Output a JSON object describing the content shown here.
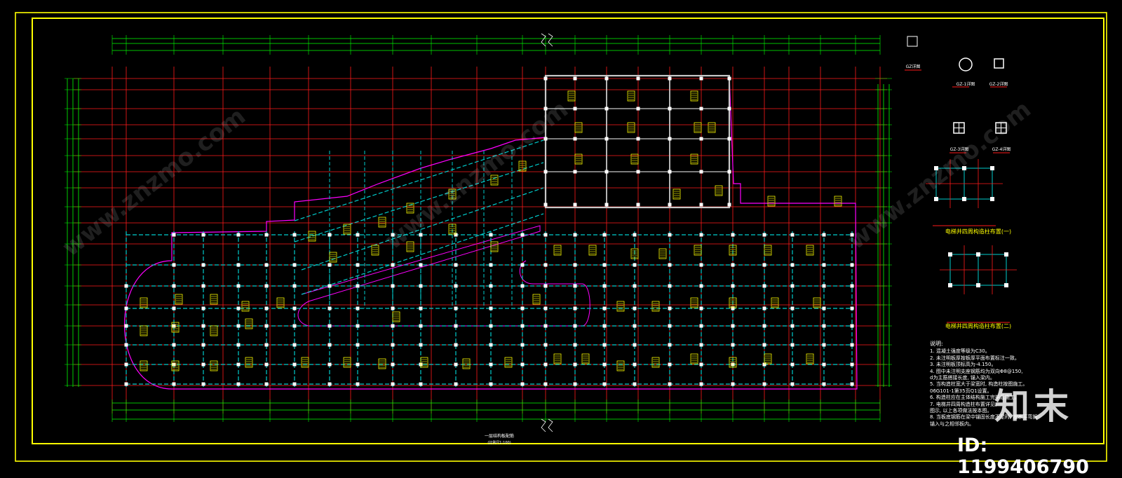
{
  "drawing": {
    "plan_title": "一层结构板配筋",
    "plan_scale": "(比例尺1:100)",
    "detail_labels": [
      "GZ-1详图",
      "GZ-2详图",
      "GZ-3详图",
      "GZ-4详图",
      "GZ详图"
    ],
    "elevator_titles": [
      "电梯井四周构造柱布置(一)",
      "电梯井四周构造柱布置(二)"
    ],
    "notes_heading": "说明:",
    "notes": [
      "1. 混凝土强度等级为C30。",
      "2. 未注明板厚按板厚平面布置标注一致。",
      "3. 未注明板顶标高为-4.150。",
      "4. 图中未注明支座钢筋均为双向Φ8@150,",
      "   d为主筋搭接长度, 锚入梁内。",
      "5. 当构造柱宽大于梁宽时, 构造柱按图施工。",
      "   06G101-1第35页Q1设置。",
      "6. 构造柱应在主体结构施工完毕后施工。",
      "7. 电梯井四周构造柱布置详见。",
      "   图示, 以上各项做法按本图。",
      "8. 当板底钢筋在梁中锚固长度不足时, 按水平弯折",
      "   锚入与之相邻板内。"
    ]
  },
  "colors": {
    "frame": "#ffff00",
    "grid_red": "#ff1a1a",
    "dim_green": "#00ff00",
    "beam_white": "#ffffff",
    "beam_cyan": "#00cccc",
    "outline_magenta": "#ff00ff",
    "tag_yellow": "#ffff00",
    "wall_grey": "#c8c8c8"
  },
  "watermark": {
    "logo": "知末",
    "id_text": "ID: 1199406790",
    "site": "www.znzmo.com"
  }
}
